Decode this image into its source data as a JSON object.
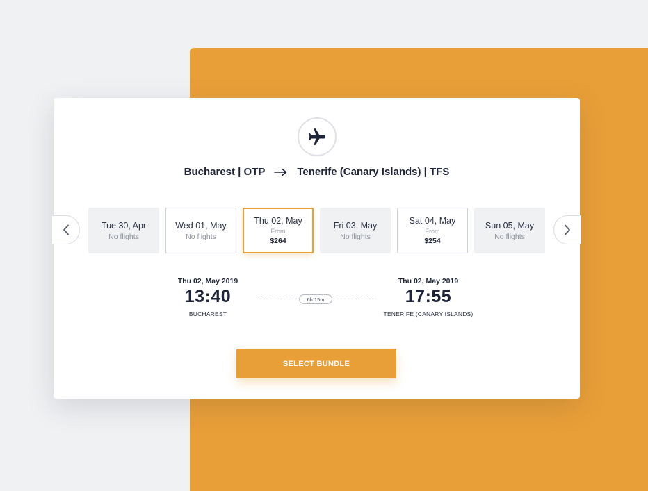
{
  "route": {
    "origin": "Bucharest | OTP",
    "destination": "Tenerife (Canary Islands) | TFS"
  },
  "icons": {
    "plane": "plane-icon",
    "arrow": "arrow-right-icon",
    "prev": "chevron-left-icon",
    "next": "chevron-right-icon"
  },
  "dates": [
    {
      "label": "Tue 30, Apr",
      "sub": "No flights",
      "state": "empty"
    },
    {
      "label": "Wed 01, May",
      "sub": "No flights",
      "state": "avail"
    },
    {
      "label": "Thu 02, May",
      "from": "From",
      "price": "$264",
      "state": "selected"
    },
    {
      "label": "Fri 03, May",
      "sub": "No flights",
      "state": "empty"
    },
    {
      "label": "Sat 04, May",
      "from": "From",
      "price": "$254",
      "state": "avail"
    },
    {
      "label": "Sun 05, May",
      "sub": "No flights",
      "state": "empty"
    }
  ],
  "flight": {
    "departure": {
      "date": "Thu 02, May 2019",
      "time": "13:40",
      "city": "BUCHAREST"
    },
    "arrival": {
      "date": "Thu 02, May 2019",
      "time": "17:55",
      "city": "TENERIFE (CANARY ISLANDS)"
    },
    "duration": "6h 15m"
  },
  "action": {
    "select_label": "SELECT BUNDLE"
  },
  "colors": {
    "accent": "#e99f38",
    "text": "#1f2538",
    "background": "#f0f1f3"
  }
}
